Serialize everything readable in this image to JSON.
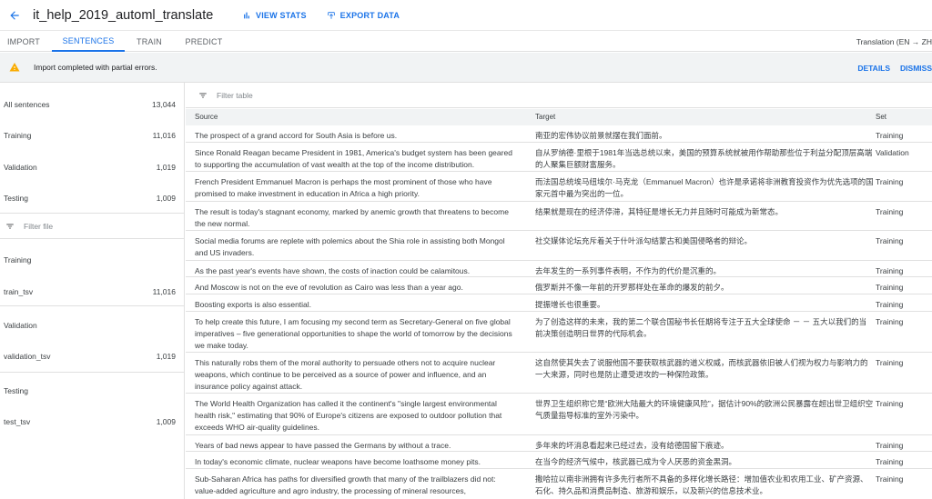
{
  "header": {
    "title": "it_help_2019_automl_translate",
    "view_stats": "VIEW STATS",
    "export_data": "EXPORT DATA"
  },
  "tabs": [
    {
      "label": "IMPORT"
    },
    {
      "label": "SENTENCES"
    },
    {
      "label": "TRAIN"
    },
    {
      "label": "PREDICT"
    }
  ],
  "model_name": "Translation (EN → ZH",
  "alert": {
    "text": "Import completed with partial errors.",
    "details": "DETAILS",
    "dismiss": "DISMISS"
  },
  "sidebar": {
    "stats": [
      {
        "label": "All sentences",
        "count": "13,044"
      },
      {
        "label": "Training",
        "count": "11,016"
      },
      {
        "label": "Validation",
        "count": "1,019"
      },
      {
        "label": "Testing",
        "count": "1,009"
      }
    ],
    "filter_placeholder": "Filter file",
    "groups": [
      {
        "heading": "Training",
        "file": "train_tsv",
        "count": "11,016"
      },
      {
        "heading": "Validation",
        "file": "validation_tsv",
        "count": "1,019"
      },
      {
        "heading": "Testing",
        "file": "test_tsv",
        "count": "1,009"
      }
    ]
  },
  "table": {
    "filter_placeholder": "Filter table",
    "columns": {
      "source": "Source",
      "target": "Target",
      "set": "Set"
    },
    "rows": [
      {
        "source": "The prospect of a grand accord for South Asia is before us.",
        "target": "南亚的宏伟协议前景就摆在我们面前。",
        "set": "Training"
      },
      {
        "source": "Since Ronald Reagan became President in 1981, America's budget system has been geared to supporting the accumulation of vast wealth at the top of the income distribution.",
        "target": "自从罗纳德·里根于1981年当选总统以来，美国的预算系统就被用作帮助那些位于利益分配顶层高端的人聚集巨额财富服务。",
        "set": "Validation"
      },
      {
        "source": "French President Emmanuel Macron is perhaps the most prominent of those who have promised to make investment in education in Africa a high priority.",
        "target": "而法国总统埃马纽埃尔·马克龙（Emmanuel Macron）也许是承诺将非洲教育投资作为优先选项的国家元首中最为突出的一位。",
        "set": "Training"
      },
      {
        "source": "The result is today's stagnant economy, marked by anemic growth that threatens to become the new normal.",
        "target": "结果就是现在的经济停滞，其特征是增长无力并且随时可能成为新常态。",
        "set": "Training"
      },
      {
        "source": "Social media forums are replete with polemics about the Shia role in assisting both Mongol and US invaders.",
        "target": "社交媒体论坛充斥着关于什叶派勾结蒙古和美国侵略者的辩论。",
        "set": "Training"
      },
      {
        "source": "As the past year's events have shown, the costs of inaction could be calamitous.",
        "target": "去年发生的一系列事件表明，不作为的代价是沉重的。",
        "set": "Training"
      },
      {
        "source": "And Moscow is not on the eve of revolution as Cairo was less than a year ago.",
        "target": "俄罗斯并不像一年前的开罗那样处在革命的爆发的前夕。",
        "set": "Training"
      },
      {
        "source": "Boosting exports is also essential.",
        "target": "提振增长也很重要。",
        "set": "Training"
      },
      {
        "source": "To help create this future, I am focusing my second term as Secretary-General on five global imperatives – five generational opportunities to shape the world of tomorrow by the decisions we make today.",
        "target": "为了创造这样的未来，我的第二个联合国秘书长任期将专注于五大全球使命 － － 五大以我们的当前决策创造明日世界的代际机会。",
        "set": "Training"
      },
      {
        "source": "This naturally robs them of the moral authority to persuade others not to acquire nuclear weapons, which continue to be perceived as a source of power and influence, and an insurance policy against attack.",
        "target": "这自然使其失去了说服他国不要获取核武器的道义权威，而核武器依旧被人们视为权力与影响力的一大来源，同时也是防止遭受进攻的一种保险政策。",
        "set": "Training"
      },
      {
        "source": "The World Health Organization has called it the continent's \"single largest environmental health risk,\" estimating that 90% of Europe's citizens are exposed to outdoor pollution that exceeds WHO air-quality guidelines.",
        "target": "世界卫生组织称它是“欧洲大陆最大的环境健康风险”，据估计90%的欧洲公民暴露在超出世卫组织空气质量指导标准的室外污染中。",
        "set": "Training"
      },
      {
        "source": "Years of bad news appear to have passed the Germans by without a trace.",
        "target": "多年来的坏消息看起来已经过去，没有给德国留下痕迹。",
        "set": "Training"
      },
      {
        "source": "In today's economic climate, nuclear weapons have become loathsome money pits.",
        "target": "在当今的经济气候中，核武器已成为令人厌恶的资金黑洞。",
        "set": "Training"
      },
      {
        "source": "Sub-Saharan Africa has paths for diversified growth that many of the trailblazers did not: value-added agriculture and agro industry, the processing of mineral resources,",
        "target": "撒哈拉以南非洲拥有许多先行者所不具备的多样化增长路径：增加值农业和农用工业、矿产资源、石化、持久品和消费品制造、旅游和娱乐，以及新兴的信息技术业。",
        "set": "Training"
      }
    ]
  }
}
